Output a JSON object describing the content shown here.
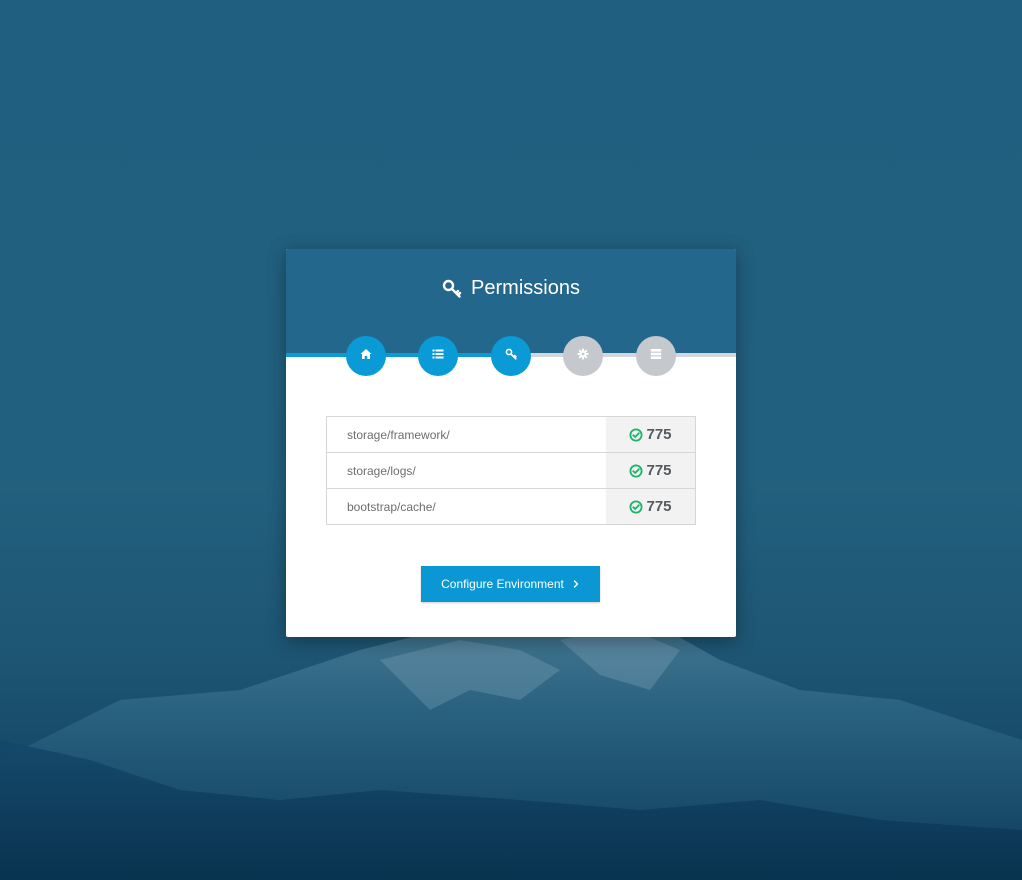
{
  "header": {
    "title": "Permissions",
    "title_icon": "key-icon"
  },
  "steps": [
    {
      "icon": "home-icon",
      "state": "active"
    },
    {
      "icon": "list-icon",
      "state": "active"
    },
    {
      "icon": "key-icon",
      "state": "active"
    },
    {
      "icon": "gear-icon",
      "state": "inactive"
    },
    {
      "icon": "server-icon",
      "state": "inactive"
    }
  ],
  "permissions": [
    {
      "path": "storage/framework/",
      "value": "775",
      "status_icon": "check-circle-icon"
    },
    {
      "path": "storage/logs/",
      "value": "775",
      "status_icon": "check-circle-icon"
    },
    {
      "path": "bootstrap/cache/",
      "value": "775",
      "status_icon": "check-circle-icon"
    }
  ],
  "actions": {
    "next_label": "Configure Environment",
    "next_icon": "chevron-right-icon"
  },
  "colors": {
    "header_bg": "#24678c",
    "accent": "#0a9ad6",
    "inactive": "#c5c8cc",
    "success": "#19b36b"
  }
}
